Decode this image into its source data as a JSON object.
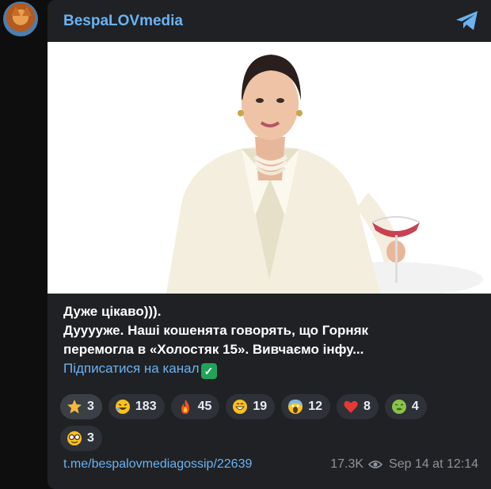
{
  "channel": {
    "name": "BespaLOVmedia"
  },
  "post": {
    "text_line1": "Дуже цікаво))).",
    "text_line2": "Дууууже. Наші кошенята говорять, що Горняк",
    "text_line3": "перемогла в «Холостяк 15». Вивчаємо інфу...",
    "subscribe_text": "Підписатися на канал",
    "reactions": [
      {
        "icon": "star-icon",
        "count": "3"
      },
      {
        "icon": "rofl-face-icon",
        "count": "183"
      },
      {
        "icon": "fire-icon",
        "count": "45"
      },
      {
        "icon": "grin-face-icon",
        "count": "19"
      },
      {
        "icon": "screaming-face-icon",
        "count": "12"
      },
      {
        "icon": "red-heart-icon",
        "count": "8"
      },
      {
        "icon": "nauseated-face-icon",
        "count": "4"
      },
      {
        "icon": "nerd-face-icon",
        "count": "3"
      }
    ],
    "link": "t.me/bespalovmediagossip/22639",
    "views": "17.3K",
    "timestamp": "Sep 14 at 12:14"
  },
  "colors": {
    "accent": "#6ab3f3",
    "bubble": "#202124",
    "reaction_bg": "#2e3137",
    "check": "#21a35a"
  }
}
